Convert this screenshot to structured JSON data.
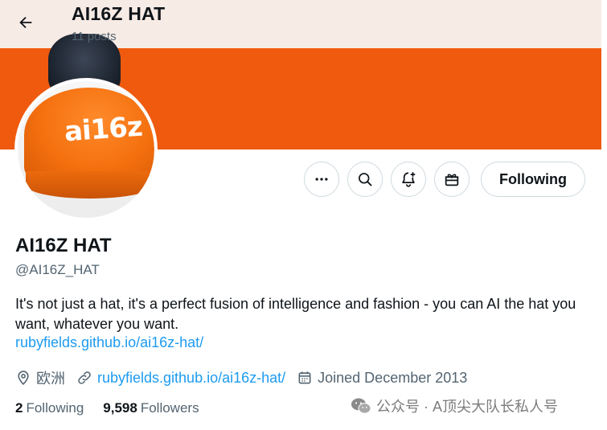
{
  "header": {
    "title": "AI16Z HAT",
    "posts": "11 posts"
  },
  "avatar": {
    "text": "ai16z"
  },
  "actions": {
    "more_icon": "more-icon",
    "search_icon": "search-icon",
    "notify_icon": "bell-plus-icon",
    "subscribe_icon": "gift-icon",
    "follow_label": "Following"
  },
  "profile": {
    "name": "AI16Z HAT",
    "handle": "@AI16Z_HAT",
    "bio": "It's not just a hat, it's a perfect fusion of intelligence and fashion - you can AI the hat you want, whatever you want.",
    "bio_link": "rubyfields.github.io/ai16z-hat/",
    "location": "欧洲",
    "website": "rubyfields.github.io/ai16z-hat/",
    "joined": "Joined December 2013"
  },
  "stats": {
    "following_count": "2",
    "following_label": "Following",
    "followers_count": "9,598",
    "followers_label": "Followers"
  },
  "watermark": {
    "text": "公众号 · A顶尖大队长私人号"
  },
  "colors": {
    "banner": "#ef5a0e",
    "link": "#1d9bf0",
    "muted": "#536471"
  }
}
